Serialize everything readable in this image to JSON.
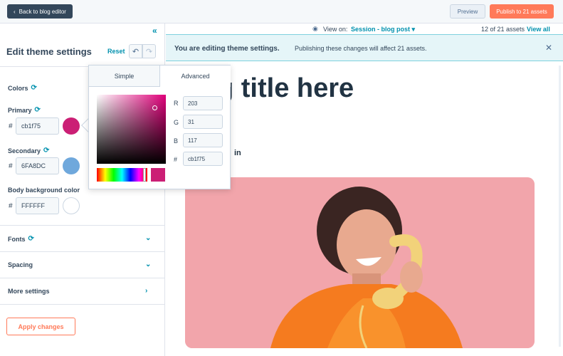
{
  "topbar": {
    "back_label": "Back to blog editor",
    "preview_label": "Preview",
    "publish_label": "Publish to 21 assets"
  },
  "sidebar": {
    "title": "Edit theme settings",
    "reset_label": "Reset",
    "colors_label": "Colors",
    "primary_label": "Primary",
    "primary_value": "cb1f75",
    "secondary_label": "Secondary",
    "secondary_value": "6FA8DC",
    "bodybg_label": "Body background color",
    "bodybg_value": "FFFFFF",
    "hash": "#",
    "fonts_label": "Fonts",
    "spacing_label": "Spacing",
    "more_label": "More settings",
    "apply_label": "Apply changes"
  },
  "colors": {
    "primary": "#cb1f75",
    "secondary": "#6FA8DC",
    "body_bg": "#FFFFFF",
    "accent": "#ff7a59",
    "link": "#0091ae",
    "dark": "#33475b"
  },
  "view": {
    "view_on": "View on:",
    "session": "Session - blog post",
    "count": "12 of 21 assets",
    "view_all": "View all"
  },
  "banner": {
    "bold": "You are editing theme settings.",
    "text": "Publishing these changes will affect 21 assets."
  },
  "preview": {
    "title_fragment": "g title here",
    "author_fragment": "in"
  },
  "picker": {
    "tab_simple": "Simple",
    "tab_advanced": "Advanced",
    "r_label": "R",
    "r_value": "203",
    "g_label": "G",
    "g_value": "31",
    "b_label": "B",
    "b_value": "117",
    "hex_label": "#",
    "hex_value": "cb1f75"
  },
  "icons": {
    "back": "chevron-left-icon",
    "collapse": "double-chevron-left-icon",
    "undo": "undo-icon",
    "redo": "redo-icon",
    "sync": "sync-icon",
    "eye": "eye-icon",
    "close": "close-icon"
  }
}
